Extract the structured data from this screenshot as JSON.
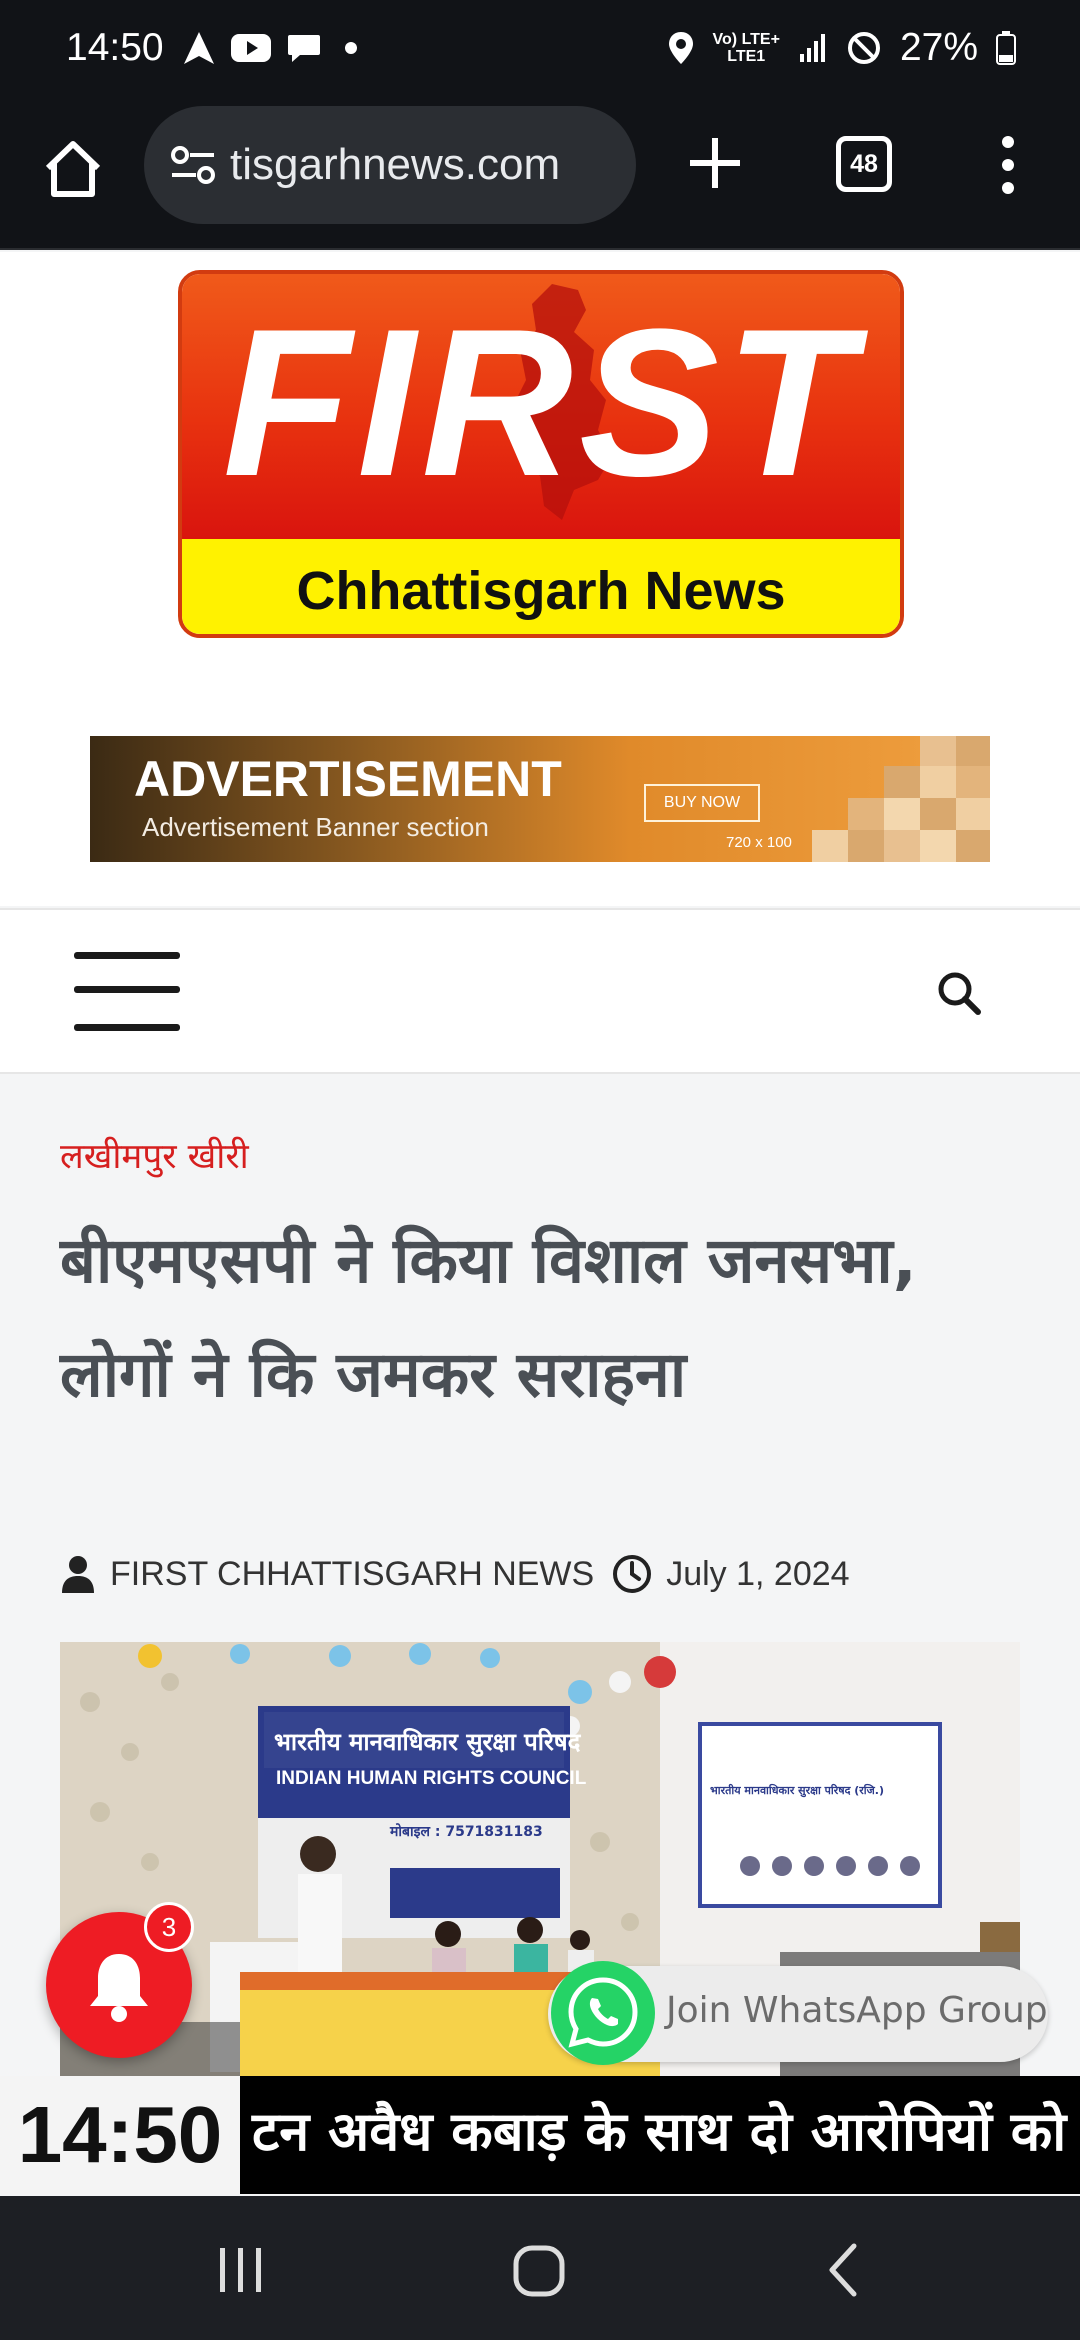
{
  "status_bar": {
    "time": "14:50",
    "battery": "27%",
    "network_top": "Vo) LTE+",
    "network_bottom": "LTE1",
    "icons": [
      "navigation-icon",
      "youtube-icon",
      "chat-icon",
      "dot-icon",
      "location-icon",
      "signal-icon",
      "dnd-icon",
      "battery-icon"
    ]
  },
  "browser": {
    "url": "tisgarhnews.com",
    "tab_count": "48",
    "icons": [
      "home-icon",
      "site-settings-icon",
      "plus-icon",
      "tabs-icon",
      "more-vert-icon"
    ]
  },
  "header": {
    "logo_main": "FIRST",
    "logo_sub": "Chhattisgarh News",
    "logo_colors": {
      "top": "#e8320f",
      "bottom": "#fff200"
    }
  },
  "ad": {
    "title": "ADVERTISEMENT",
    "subtitle": "Advertisement Banner section",
    "button": "BUY NOW",
    "size": "720 x 100"
  },
  "nav": {
    "icons": [
      "hamburger-icon",
      "search-icon"
    ]
  },
  "article": {
    "category": "लखीमपुर खीरी",
    "headline": "बीएमएसपी ने किया विशाल जनसभा, लोगों ने कि जमकर सराहना",
    "author": "FIRST CHHATTISGARH NEWS",
    "date": "July 1, 2024",
    "photo": {
      "banner_left_hindi": "भारतीय मानवाधिकार सुरक्षा परिषद",
      "banner_left_english": "INDIAN HUMAN RIGHTS COUNCIL",
      "banner_left_phone": "मोबाइल : 7571831183",
      "banner_right_hindi": "भारतीय मानवाधिकार सुरक्षा परिषद (रजि.)"
    }
  },
  "floating": {
    "notification_count": "3",
    "whatsapp_label": "Join WhatsApp Group"
  },
  "ticker": {
    "clock": "14:50",
    "text": "टन अवैध कबाड़ के साथ दो आरोपियों को"
  },
  "colors": {
    "accent_red": "#d61f1f",
    "headline_gray": "#4a4f55",
    "whatsapp_green": "#25d366",
    "status_bg": "#111317"
  }
}
